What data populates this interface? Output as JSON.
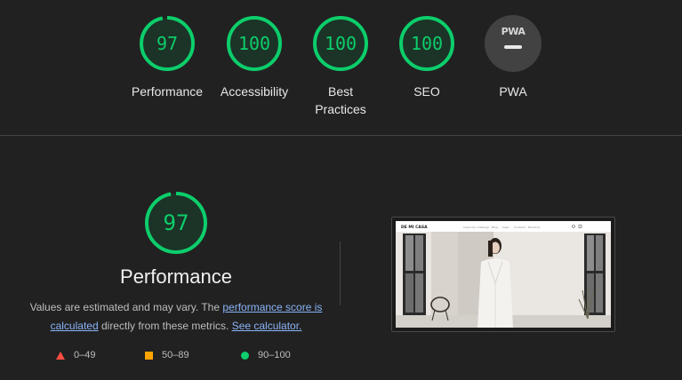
{
  "scores": [
    {
      "name": "performance",
      "value": "97",
      "score": 97,
      "label": "Performance",
      "color": "#0cce6b"
    },
    {
      "name": "accessibility",
      "value": "100",
      "score": 100,
      "label": "Accessibility",
      "color": "#0cce6b"
    },
    {
      "name": "best-practices",
      "value": "100",
      "score": 100,
      "label": "Best\nPractices",
      "color": "#0cce6b"
    },
    {
      "name": "seo",
      "value": "100",
      "score": 100,
      "label": "SEO",
      "color": "#0cce6b"
    },
    {
      "name": "pwa",
      "value": "PWA",
      "label": "PWA",
      "color": "#424242"
    }
  ],
  "performance_section": {
    "score": "97",
    "score_value": 97,
    "title": "Performance",
    "desc_prefix": "Values are estimated and may vary. The ",
    "desc_link1": "performance score is calculated",
    "desc_middle": " directly from these metrics. ",
    "desc_link2": "See calculator.",
    "legend": [
      {
        "shape": "triangle",
        "range": "0–49",
        "color": "#ff4e42"
      },
      {
        "shape": "square",
        "range": "50–89",
        "color": "#ffa400"
      },
      {
        "shape": "circle",
        "range": "90–100",
        "color": "#0cce6b"
      }
    ]
  },
  "thumbnail": {
    "brand": "DE MI CASA",
    "nav": [
      "Colección",
      "Catálogo",
      "Blog",
      "Casa",
      "Contacto",
      "Nosotros"
    ]
  }
}
